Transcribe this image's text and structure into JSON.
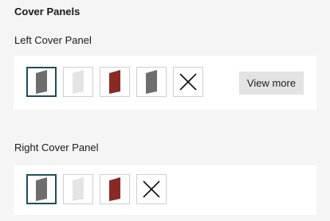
{
  "section_title": "Cover Panels",
  "left": {
    "label": "Left Cover Panel",
    "view_more_label": "View more",
    "options": [
      {
        "color": "#6e6e6e",
        "icon": "panel-gray",
        "selected": true
      },
      {
        "color": "#e4e4e4",
        "icon": "panel-light",
        "selected": false
      },
      {
        "color": "#8a2a24",
        "icon": "panel-red",
        "selected": false
      },
      {
        "color": "#6e6e6e",
        "icon": "panel-gray",
        "selected": false
      },
      {
        "icon": "close-icon",
        "selected": false
      }
    ]
  },
  "right": {
    "label": "Right Cover Panel",
    "options": [
      {
        "color": "#6e6e6e",
        "icon": "panel-gray",
        "selected": true
      },
      {
        "color": "#e4e4e4",
        "icon": "panel-light",
        "selected": false
      },
      {
        "color": "#8a2a24",
        "icon": "panel-red",
        "selected": false
      },
      {
        "icon": "close-icon",
        "selected": false
      }
    ]
  }
}
